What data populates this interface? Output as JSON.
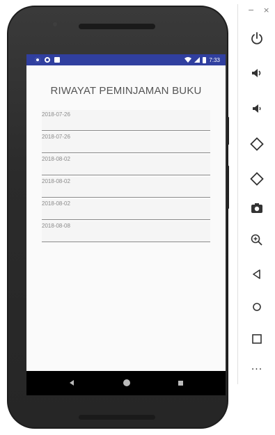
{
  "status_bar": {
    "time": "7:33",
    "left_icons": [
      "gear-icon",
      "circle-icon",
      "sd-card-icon"
    ],
    "right_icons": [
      "wifi-icon",
      "signal-icon",
      "battery-icon"
    ],
    "color": "#303f9f"
  },
  "app": {
    "title": "RIWAYAT PEMINJAMAN BUKU",
    "items": [
      {
        "date": "2018-07-26"
      },
      {
        "date": "2018-07-26"
      },
      {
        "date": "2018-08-02"
      },
      {
        "date": "2018-08-02"
      },
      {
        "date": "2018-08-02"
      },
      {
        "date": "2018-08-08"
      }
    ]
  },
  "nav_bar": {
    "buttons": [
      "back-icon",
      "home-icon",
      "recents-icon"
    ]
  },
  "emulator_toolbar": {
    "window_controls": {
      "minimize": "−",
      "close": "×"
    },
    "tools": [
      "power-icon",
      "volume-up-icon",
      "volume-down-icon",
      "rotate-left-icon",
      "rotate-right-icon",
      "camera-icon",
      "zoom-icon",
      "back-icon",
      "home-icon",
      "overview-icon",
      "more-icon"
    ],
    "more_label": "···"
  }
}
